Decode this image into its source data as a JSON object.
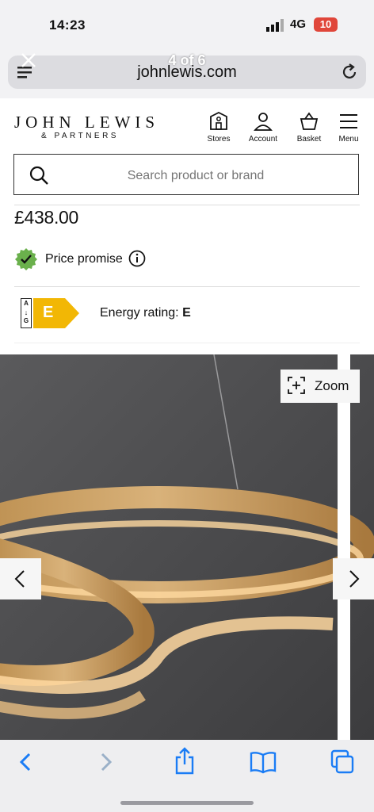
{
  "status": {
    "time": "14:23",
    "network": "4G",
    "battery": "10"
  },
  "browser": {
    "domain": "johnlewis.com",
    "pager": "4 of 6"
  },
  "logo": {
    "line1": "JOHN LEWIS",
    "line2": "& PARTNERS"
  },
  "nav": {
    "stores": "Stores",
    "account": "Account",
    "basket": "Basket",
    "menu": "Menu"
  },
  "search": {
    "placeholder": "Search product or brand"
  },
  "product": {
    "price": "£438.00",
    "price_promise": "Price promise",
    "energy_scale": [
      "A",
      "G"
    ],
    "energy_class": "E",
    "energy_label": "Energy rating: ",
    "energy_value": "E"
  },
  "gallery": {
    "zoom_label": "Zoom"
  },
  "colors": {
    "accent_blue": "#1a7cf5",
    "energy_yellow": "#f2b705",
    "promise_green": "#6ab04c"
  }
}
